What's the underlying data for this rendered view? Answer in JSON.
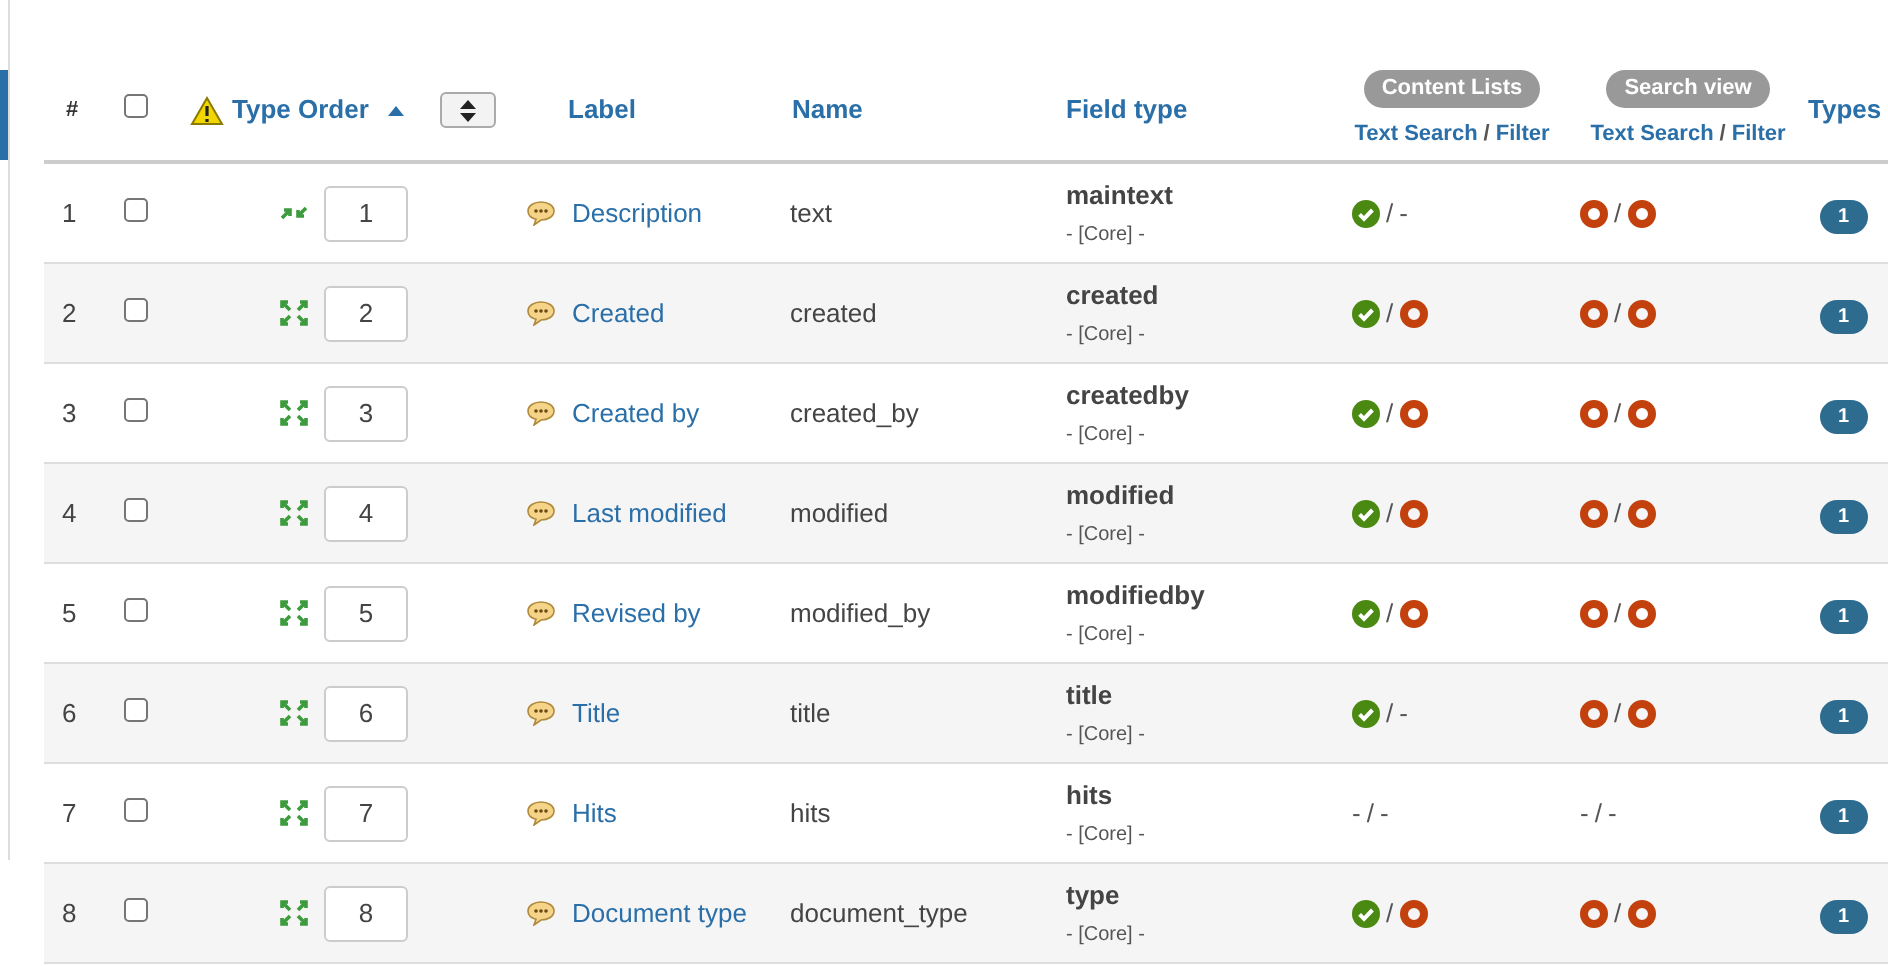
{
  "table": {
    "columns": {
      "number": "#",
      "all_checked": false,
      "type_order": "Type Order",
      "label": "Label",
      "name": "Name",
      "field_type": "Field type",
      "content_lists": {
        "group": "Content Lists",
        "text_search": "Text Search",
        "sep": "/",
        "filter": "Filter"
      },
      "search_view": {
        "group": "Search view",
        "text_search": "Text Search",
        "sep": "/",
        "filter": "Filter"
      },
      "types": "Types"
    },
    "sort_ascending": true,
    "rows": [
      {
        "number": "1",
        "checked": false,
        "order_handle": {
          "kind": "pair"
        },
        "order": "1",
        "label": "Description",
        "name": "text",
        "field_type": "maintext",
        "source": "- [Core] -",
        "content": {
          "sep": "/",
          "items": [
            {
              "kind": "check"
            },
            {
              "kind": "dash",
              "text": "-"
            }
          ]
        },
        "search": {
          "sep": "/",
          "items": [
            {
              "kind": "ring"
            },
            {
              "kind": "ring"
            }
          ]
        },
        "types": "1"
      },
      {
        "number": "2",
        "checked": false,
        "order_handle": {
          "kind": "quad"
        },
        "order": "2",
        "label": "Created",
        "name": "created",
        "field_type": "created",
        "source": "- [Core] -",
        "content": {
          "sep": "/",
          "items": [
            {
              "kind": "check"
            },
            {
              "kind": "ring"
            }
          ]
        },
        "search": {
          "sep": "/",
          "items": [
            {
              "kind": "ring"
            },
            {
              "kind": "ring"
            }
          ]
        },
        "types": "1"
      },
      {
        "number": "3",
        "checked": false,
        "order_handle": {
          "kind": "quad"
        },
        "order": "3",
        "label": "Created by",
        "name": "created_by",
        "field_type": "createdby",
        "source": "- [Core] -",
        "content": {
          "sep": "/",
          "items": [
            {
              "kind": "check"
            },
            {
              "kind": "ring"
            }
          ]
        },
        "search": {
          "sep": "/",
          "items": [
            {
              "kind": "ring"
            },
            {
              "kind": "ring"
            }
          ]
        },
        "types": "1"
      },
      {
        "number": "4",
        "checked": false,
        "order_handle": {
          "kind": "quad"
        },
        "order": "4",
        "label": "Last modified",
        "name": "modified",
        "field_type": "modified",
        "source": "- [Core] -",
        "content": {
          "sep": "/",
          "items": [
            {
              "kind": "check"
            },
            {
              "kind": "ring"
            }
          ]
        },
        "search": {
          "sep": "/",
          "items": [
            {
              "kind": "ring"
            },
            {
              "kind": "ring"
            }
          ]
        },
        "types": "1"
      },
      {
        "number": "5",
        "checked": false,
        "order_handle": {
          "kind": "quad"
        },
        "order": "5",
        "label": "Revised by",
        "name": "modified_by",
        "field_type": "modifiedby",
        "source": "- [Core] -",
        "content": {
          "sep": "/",
          "items": [
            {
              "kind": "check"
            },
            {
              "kind": "ring"
            }
          ]
        },
        "search": {
          "sep": "/",
          "items": [
            {
              "kind": "ring"
            },
            {
              "kind": "ring"
            }
          ]
        },
        "types": "1"
      },
      {
        "number": "6",
        "checked": false,
        "order_handle": {
          "kind": "quad"
        },
        "order": "6",
        "label": "Title",
        "name": "title",
        "field_type": "title",
        "source": "- [Core] -",
        "content": {
          "sep": "/",
          "items": [
            {
              "kind": "check"
            },
            {
              "kind": "dash",
              "text": "-"
            }
          ]
        },
        "search": {
          "sep": "/",
          "items": [
            {
              "kind": "ring"
            },
            {
              "kind": "ring"
            }
          ]
        },
        "types": "1"
      },
      {
        "number": "7",
        "checked": false,
        "order_handle": {
          "kind": "quad"
        },
        "order": "7",
        "label": "Hits",
        "name": "hits",
        "field_type": "hits",
        "source": "- [Core] -",
        "content": {
          "sep": "/",
          "items": [
            {
              "kind": "dash",
              "text": "-"
            },
            {
              "kind": "dash",
              "text": "-"
            }
          ]
        },
        "search": {
          "sep": "/",
          "items": [
            {
              "kind": "dash",
              "text": "-"
            },
            {
              "kind": "dash",
              "text": "-"
            }
          ]
        },
        "types": "1"
      },
      {
        "number": "8",
        "checked": false,
        "order_handle": {
          "kind": "quad"
        },
        "order": "8",
        "label": "Document type",
        "name": "document_type",
        "field_type": "type",
        "source": "- [Core] -",
        "content": {
          "sep": "/",
          "items": [
            {
              "kind": "check"
            },
            {
              "kind": "ring"
            }
          ]
        },
        "search": {
          "sep": "/",
          "items": [
            {
              "kind": "ring"
            },
            {
              "kind": "ring"
            }
          ]
        },
        "types": "1"
      }
    ]
  }
}
